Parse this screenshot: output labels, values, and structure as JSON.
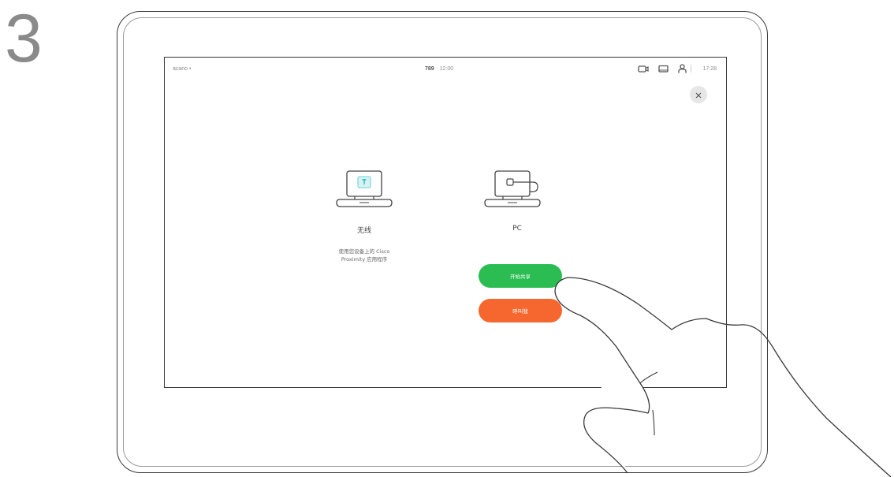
{
  "step": {
    "number": "3"
  },
  "statusbar": {
    "left_label": "acano •",
    "center_ext": "789",
    "center_time": "12:00",
    "time": "17:28"
  },
  "wireless": {
    "title": "无线",
    "desc_line1": "使用您设备上的 Cisco",
    "desc_line2": "Proximity 应用程序"
  },
  "pc": {
    "title": "PC",
    "share_label": "开始共享",
    "call_label": "呼叫我"
  },
  "colors": {
    "share_green": "#2bbd52",
    "call_orange": "#f5672e"
  }
}
